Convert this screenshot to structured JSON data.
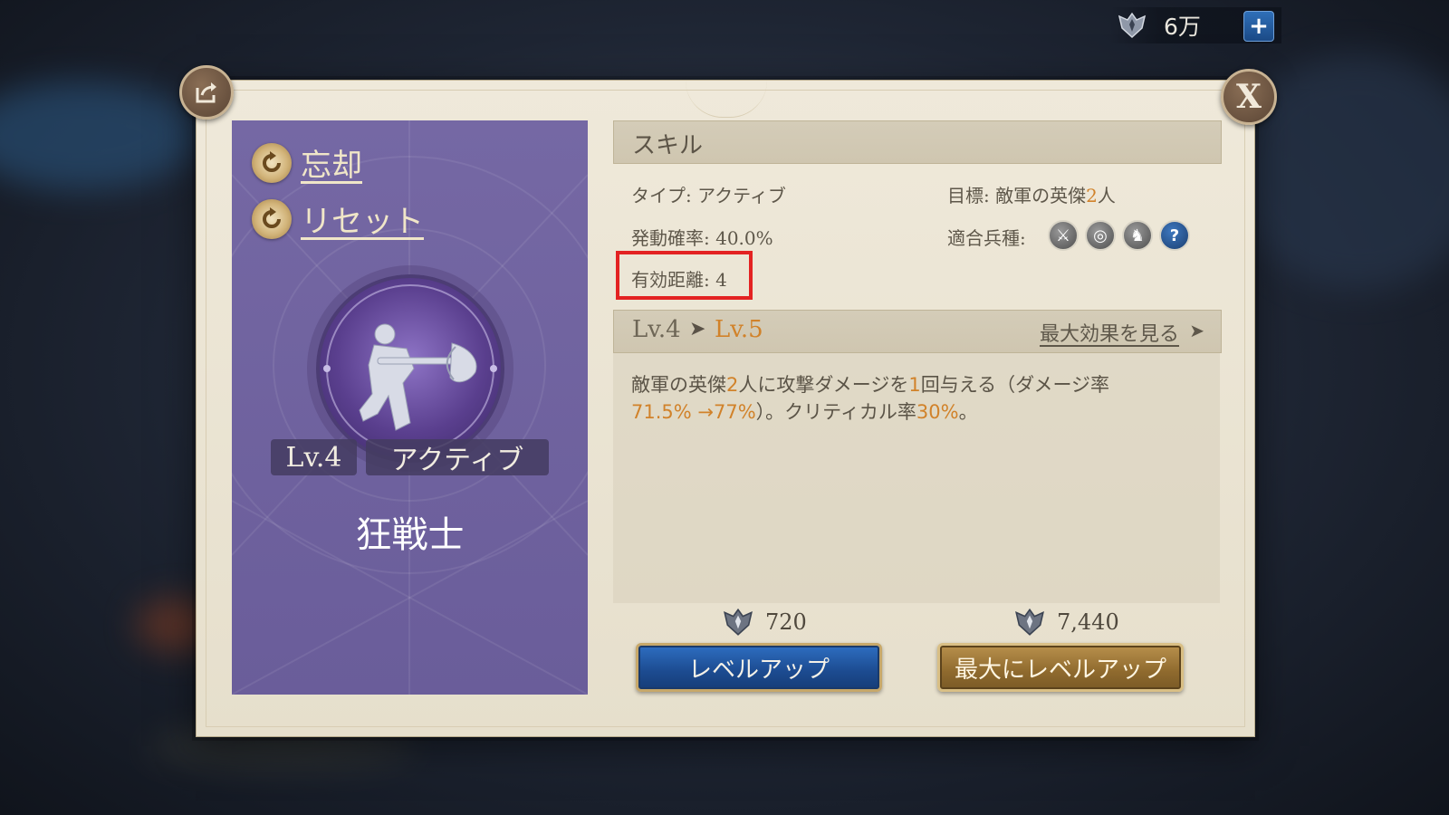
{
  "currency": {
    "amount": "6万",
    "plus_label": "+"
  },
  "dialog": {
    "close_label": "X",
    "hero": {
      "actions": [
        {
          "label": "忘却"
        },
        {
          "label": "リセット"
        }
      ],
      "level": "Lv.4",
      "type": "アクティブ",
      "name": "狂戦士"
    },
    "skill": {
      "section_title": "スキル",
      "type_label": "タイプ: アクティブ",
      "target_prefix": "目標: 敵軍の英傑",
      "target_count": "2",
      "target_suffix": "人",
      "chance_label": "発動確率: 40.0%",
      "troop_label": "適合兵種:",
      "troop_icons": [
        "sword-icon",
        "target-icon",
        "horse-icon",
        "question-icon"
      ],
      "range_label": "有効距離: 4"
    },
    "levels": {
      "from": "Lv.4",
      "arrow": "➤",
      "to": "Lv.5",
      "see_max": "最大効果を見る",
      "see_max_arrow": "➤"
    },
    "description": {
      "p1": "敵軍の英傑",
      "v1": "2",
      "p2": "人に攻撃ダメージを",
      "v2": "1",
      "p3": "回与える（ダメージ率",
      "v3": "71.5% →77%",
      "p4": "）。クリティカル率",
      "v4": "30%",
      "p5": "。"
    },
    "costs": {
      "level_up": "720",
      "max_level_up": "7,440"
    },
    "buttons": {
      "level_up": "レベルアップ",
      "max_level_up": "最大にレベルアップ"
    }
  },
  "colors": {
    "accent": "#d1822a",
    "highlight_box": "#e32222",
    "panel": "#7568a4"
  }
}
